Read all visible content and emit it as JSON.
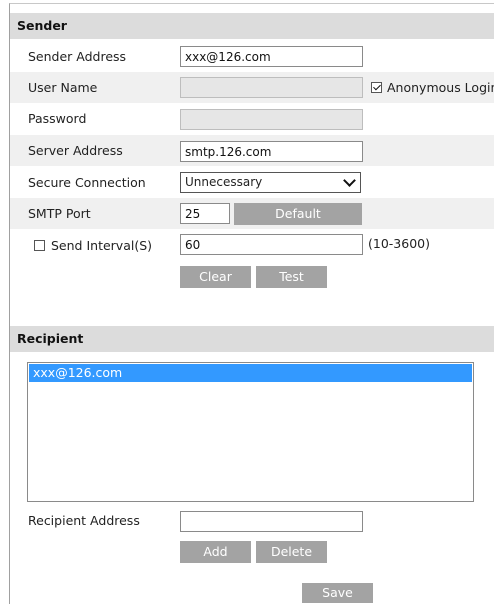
{
  "sender": {
    "title": "Sender",
    "sender_address_label": "Sender Address",
    "sender_address_value": "xxx@126.com",
    "user_name_label": "User Name",
    "user_name_value": "",
    "anonymous_login_label": "Anonymous Login",
    "anonymous_login_checked": true,
    "password_label": "Password",
    "password_value": "",
    "server_address_label": "Server Address",
    "server_address_value": "smtp.126.com",
    "secure_connection_label": "Secure Connection",
    "secure_connection_value": "Unnecessary",
    "smtp_port_label": "SMTP Port",
    "smtp_port_value": "25",
    "default_button": "Default",
    "send_interval_label": "Send Interval(S)",
    "send_interval_checked": false,
    "send_interval_value": "60",
    "send_interval_range": "(10-3600)",
    "clear_button": "Clear",
    "test_button": "Test"
  },
  "recipient": {
    "title": "Recipient",
    "list": [
      "xxx@126.com"
    ],
    "recipient_address_label": "Recipient Address",
    "recipient_address_value": "",
    "add_button": "Add",
    "delete_button": "Delete"
  },
  "save_button": "Save",
  "colors": {
    "header_bg": "#dcdcdc",
    "row_shade": "#f0f0f0",
    "button_bg": "#a3a3a3",
    "selection": "#3399ff"
  }
}
